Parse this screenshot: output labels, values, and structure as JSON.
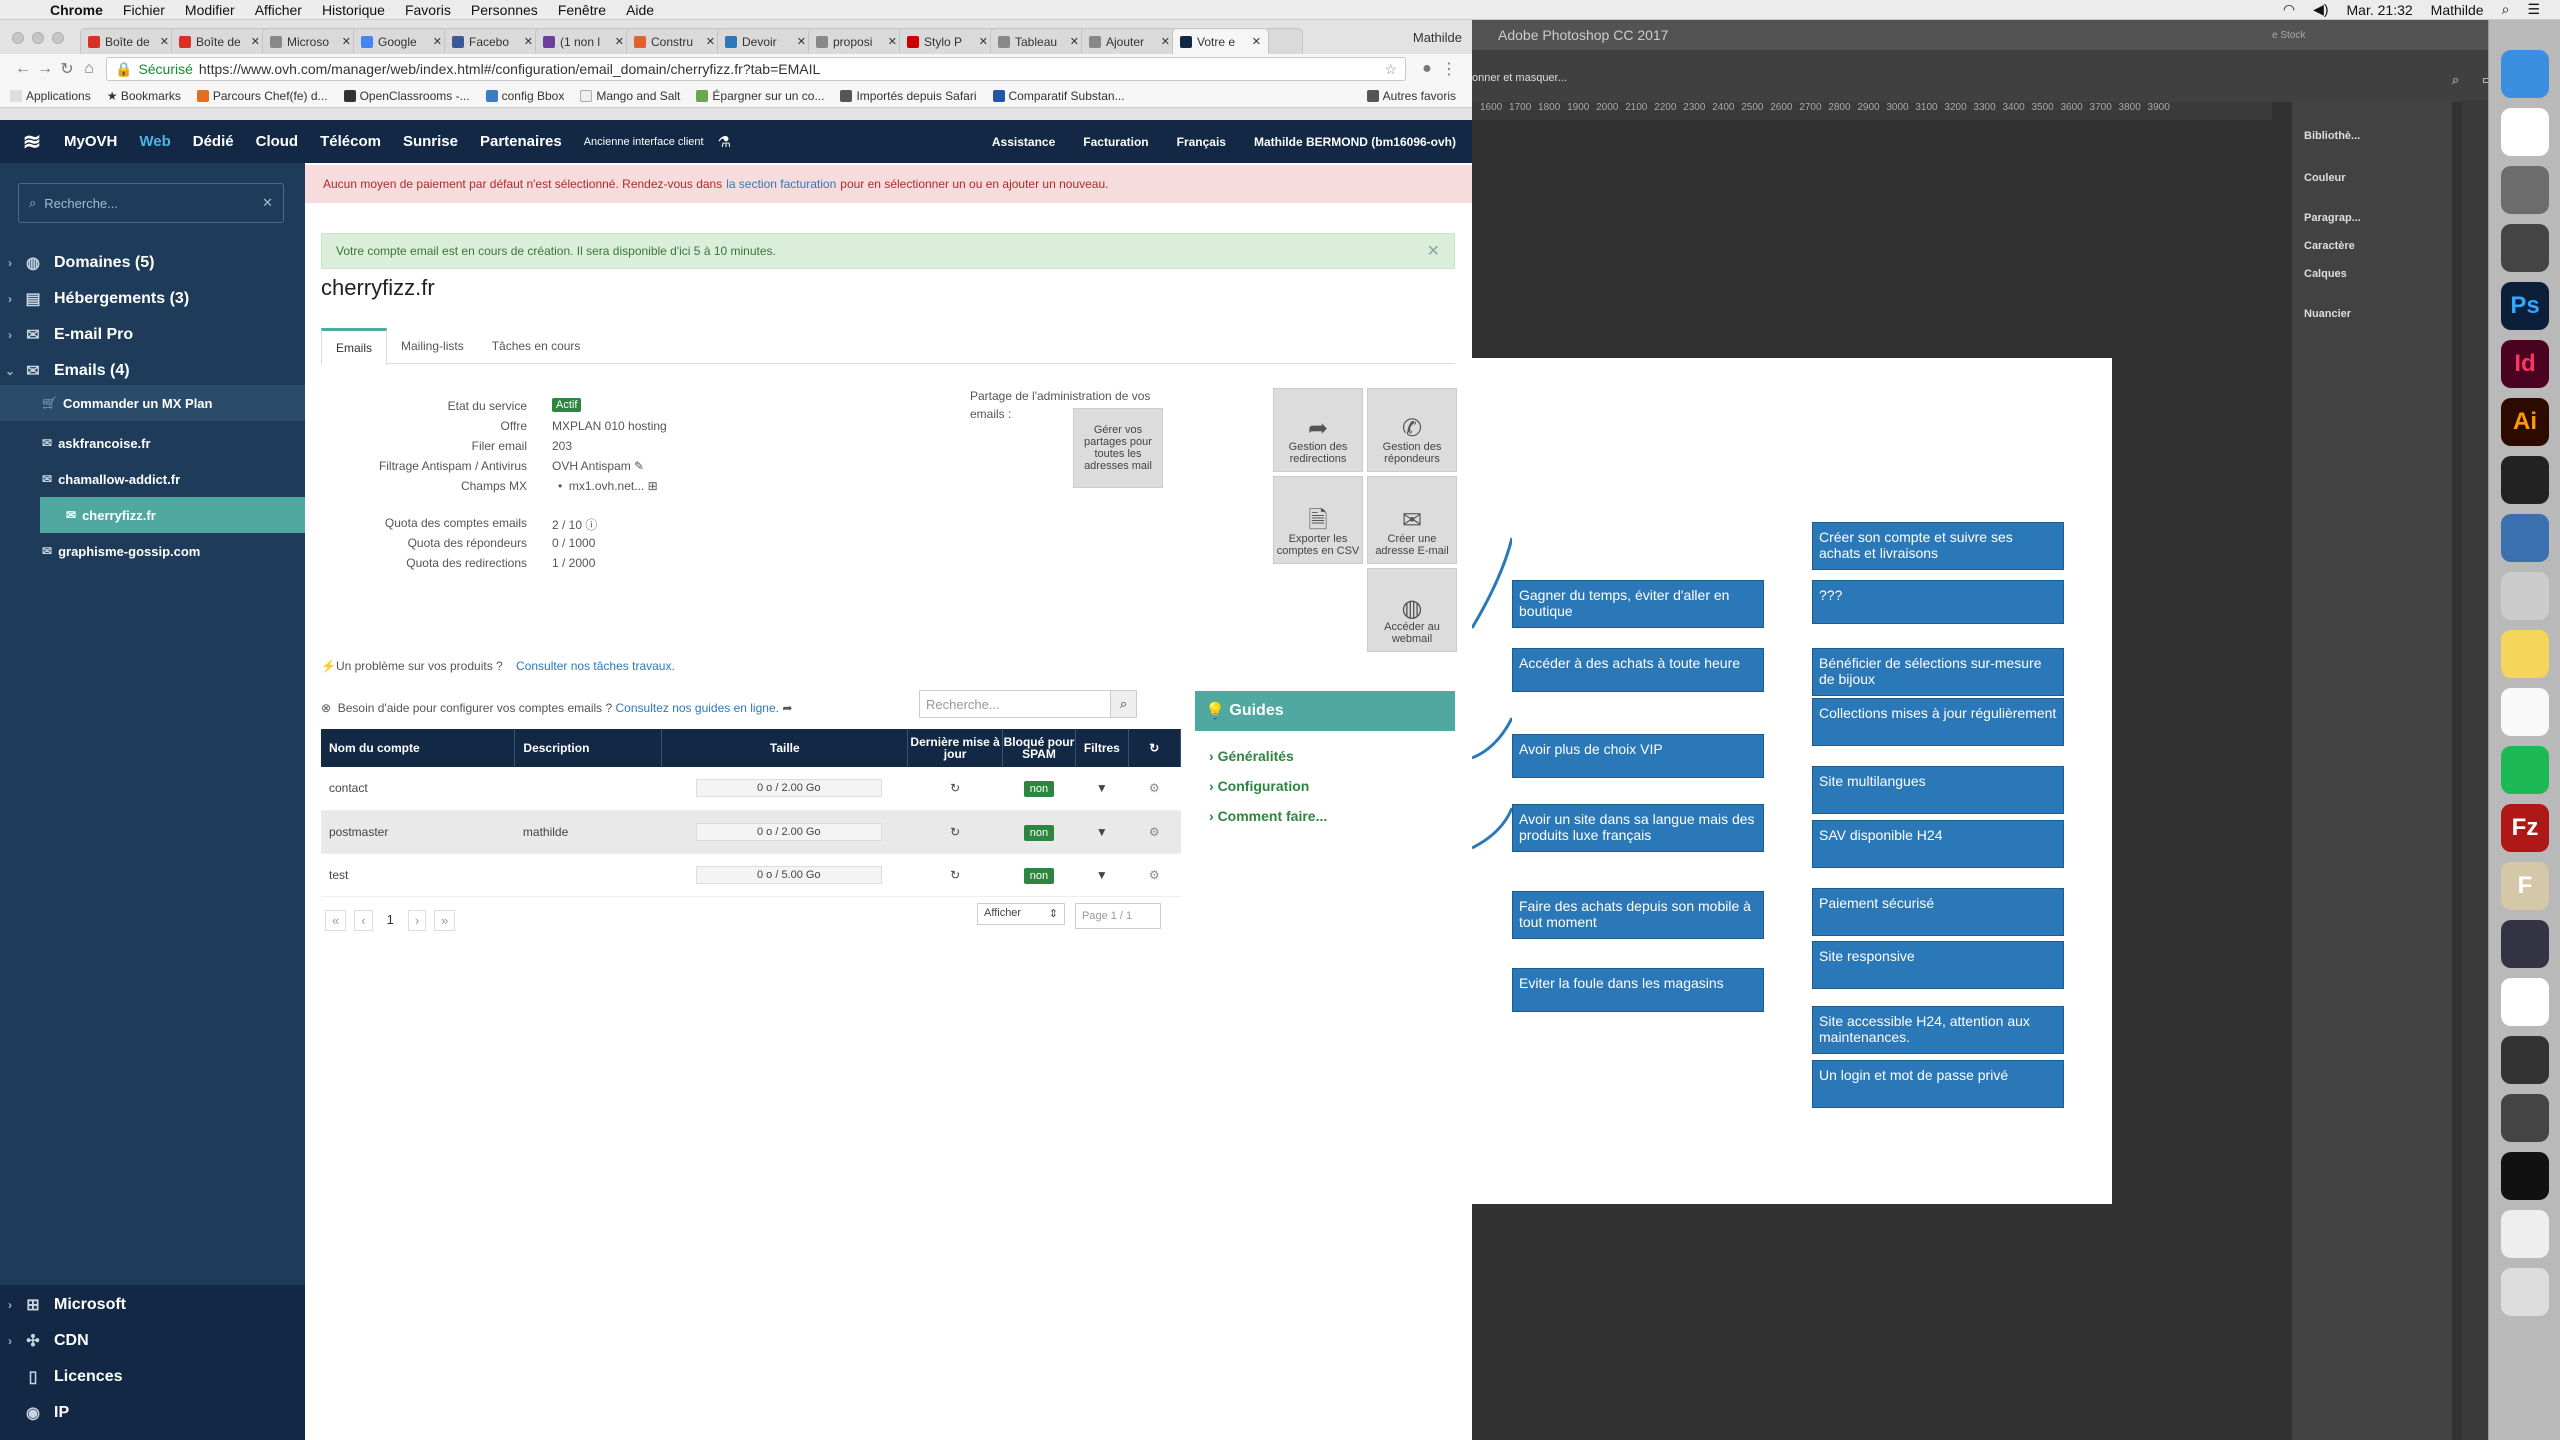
{
  "menubar": {
    "apple": "",
    "app": "Chrome",
    "items": [
      "Fichier",
      "Modifier",
      "Afficher",
      "Historique",
      "Favoris",
      "Personnes",
      "Fenêtre",
      "Aide"
    ],
    "clock": "Mar. 21:32",
    "user": "Mathilde"
  },
  "chrome": {
    "tabs": [
      {
        "label": "Boîte de",
        "color": "#d93025"
      },
      {
        "label": "Boîte de",
        "color": "#d93025"
      },
      {
        "label": "Microso",
        "color": "#888"
      },
      {
        "label": "Google",
        "color": "#4285f4"
      },
      {
        "label": "Facebo",
        "color": "#3b5998"
      },
      {
        "label": "(1 non l",
        "color": "#6a3fa0"
      },
      {
        "label": "Constru",
        "color": "#e06030"
      },
      {
        "label": "Devoir",
        "color": "#2b79b8"
      },
      {
        "label": "proposi",
        "color": "#888"
      },
      {
        "label": "Stylo P",
        "color": "#c00"
      },
      {
        "label": "Tableau",
        "color": "#888"
      },
      {
        "label": "Ajouter",
        "color": "#888"
      },
      {
        "label": "Votre e",
        "color": "#122844"
      }
    ],
    "tab_user": "Mathilde",
    "secure_label": "Sécurisé",
    "url": "https://www.ovh.com/manager/web/index.html#/configuration/email_domain/cherryfizz.fr?tab=EMAIL",
    "bookmarks": [
      "Applications",
      "Bookmarks",
      "Parcours Chef(fe) d...",
      "OpenClassrooms -...",
      "config Bbox",
      "Mango and Salt",
      "Épargner sur un co...",
      "Importés depuis Safari",
      "Comparatif Substan..."
    ],
    "other_bookmarks": "Autres favoris"
  },
  "ovh": {
    "brand": "MyOVH",
    "nav": [
      "Web",
      "Dédié",
      "Cloud",
      "Télécom",
      "Sunrise",
      "Partenaires"
    ],
    "old_interface": "Ancienne interface client",
    "right": [
      "Assistance",
      "Facturation",
      "Français",
      "Mathilde BERMOND (bm16096-ovh)"
    ]
  },
  "sidebar": {
    "search_placeholder": "Recherche...",
    "items": [
      {
        "label": "Domaines (5)"
      },
      {
        "label": "Hébergements (3)"
      },
      {
        "label": "E-mail Pro"
      },
      {
        "label": "Emails (4)"
      }
    ],
    "order_mx": "Commander un MX Plan",
    "domains": [
      "askfrancoise.fr",
      "chamallow-addict.fr",
      "cherryfizz.fr",
      "graphisme-gossip.com"
    ],
    "lower": [
      "Microsoft",
      "CDN",
      "Licences",
      "IP"
    ]
  },
  "main": {
    "alert_red": {
      "before": "Aucun moyen de paiement par défaut n'est sélectionné. Rendez-vous dans",
      "link": "la section facturation",
      "after": "pour en sélectionner un ou en ajouter un nouveau."
    },
    "alert_green": "Votre compte email est en cours de création. Il sera disponible d'ici 5 à 10 minutes.",
    "title": "cherryfizz.fr",
    "tabs": [
      "Emails",
      "Mailing-lists",
      "Tâches en cours"
    ],
    "info": [
      {
        "label": "Etat du service",
        "value": "Actif"
      },
      {
        "label": "Offre",
        "value": "MXPLAN 010 hosting"
      },
      {
        "label": "Filer email",
        "value": "203"
      },
      {
        "label": "Filtrage Antispam / Antivirus",
        "value": "OVH Antispam"
      },
      {
        "label": "Champs MX",
        "value": "mx1.ovh.net..."
      },
      {
        "label": "Quota des comptes emails",
        "value": "2 / 10"
      },
      {
        "label": "Quota des répondeurs",
        "value": "0 / 1000"
      },
      {
        "label": "Quota des redirections",
        "value": "1 / 2000"
      }
    ],
    "share_label": "Partage de l'administration de vos emails :",
    "share_tile": "Gérer vos partages pour toutes les adresses mail",
    "tiles": [
      "Gestion des redirections",
      "Gestion des répondeurs",
      "Exporter les comptes en CSV",
      "Créer une adresse E-mail",
      "Accéder au webmail"
    ],
    "problem_text": "Un problème sur vos produits ?",
    "problem_link": "Consulter nos tâches travaux.",
    "help_text": "Besoin d'aide pour configurer vos comptes emails ?",
    "help_link": "Consultez nos guides en ligne.",
    "table_search_placeholder": "Recherche...",
    "guides_title": "Guides",
    "guides": [
      "Généralités",
      "Configuration",
      "Comment faire..."
    ],
    "columns": [
      "Nom du compte",
      "Description",
      "Taille",
      "Dernière mise à jour",
      "Bloqué pour SPAM",
      "Filtres"
    ],
    "rows": [
      {
        "name": "contact",
        "description": "",
        "size": "0 o / 2.00 Go",
        "spam": "non"
      },
      {
        "name": "postmaster",
        "description": "mathilde",
        "size": "0 o / 2.00 Go",
        "spam": "non"
      },
      {
        "name": "test",
        "description": "",
        "size": "0 o / 5.00 Go",
        "spam": "non"
      }
    ],
    "page": "1",
    "show_label": "Afficher",
    "page_of": "Page 1 / 1"
  },
  "photoshop": {
    "title": "Adobe Photoshop CC 2017",
    "hide_label": "onner et masquer...",
    "ruler": "1600 1700 1800 1900 2000 2100 2200 2300 2400 2500 2600 2700 2800 2900 3000 3100 3200 3300 3400 3500 3600 3700 3800 3900",
    "stock": "e Stock",
    "panels": [
      "Bibliothè...",
      "Couleur",
      "Paragrap...",
      "Caractère",
      "Calques",
      "Nuancier"
    ],
    "left_boxes": [
      "Gagner du temps, éviter d'aller en boutique",
      "Accéder à des achats à toute heure",
      "Avoir plus de choix VIP",
      "Avoir un site dans sa langue mais des produits luxe français",
      "Faire des achats depuis son mobile à tout moment",
      "Eviter la foule dans les magasins"
    ],
    "right_boxes": [
      "Créer son compte et suivre ses achats et livraisons",
      "???",
      "Bénéficier de sélections sur-mesure de bijoux",
      "Collections mises à jour régulièrement",
      "Site multilangues",
      "SAV disponible H24",
      "Paiement sécurisé",
      "Site responsive",
      "Site accessible H24, attention aux maintenances.",
      "Un login et mot de passe privé"
    ]
  },
  "dock": [
    "finder-icon",
    "chrome-icon",
    "calculator-icon",
    "webcam-icon",
    "Ps",
    "Id",
    "Ai",
    "clock-icon",
    "preview-icon",
    "script-icon",
    "notes-icon",
    "music-icon",
    "spotify-icon",
    "Fz",
    "F",
    "rocket-icon",
    "photos-icon",
    "stack-icon",
    "dashboard-icon",
    "acrobat-icon",
    "document-icon",
    "trash-icon"
  ],
  "colors": {
    "ovh_navy": "#122844",
    "sidebar": "#1e3c5a",
    "teal": "#4fa9a0",
    "green": "#2e8540",
    "ps_box": "#2a78b8"
  }
}
